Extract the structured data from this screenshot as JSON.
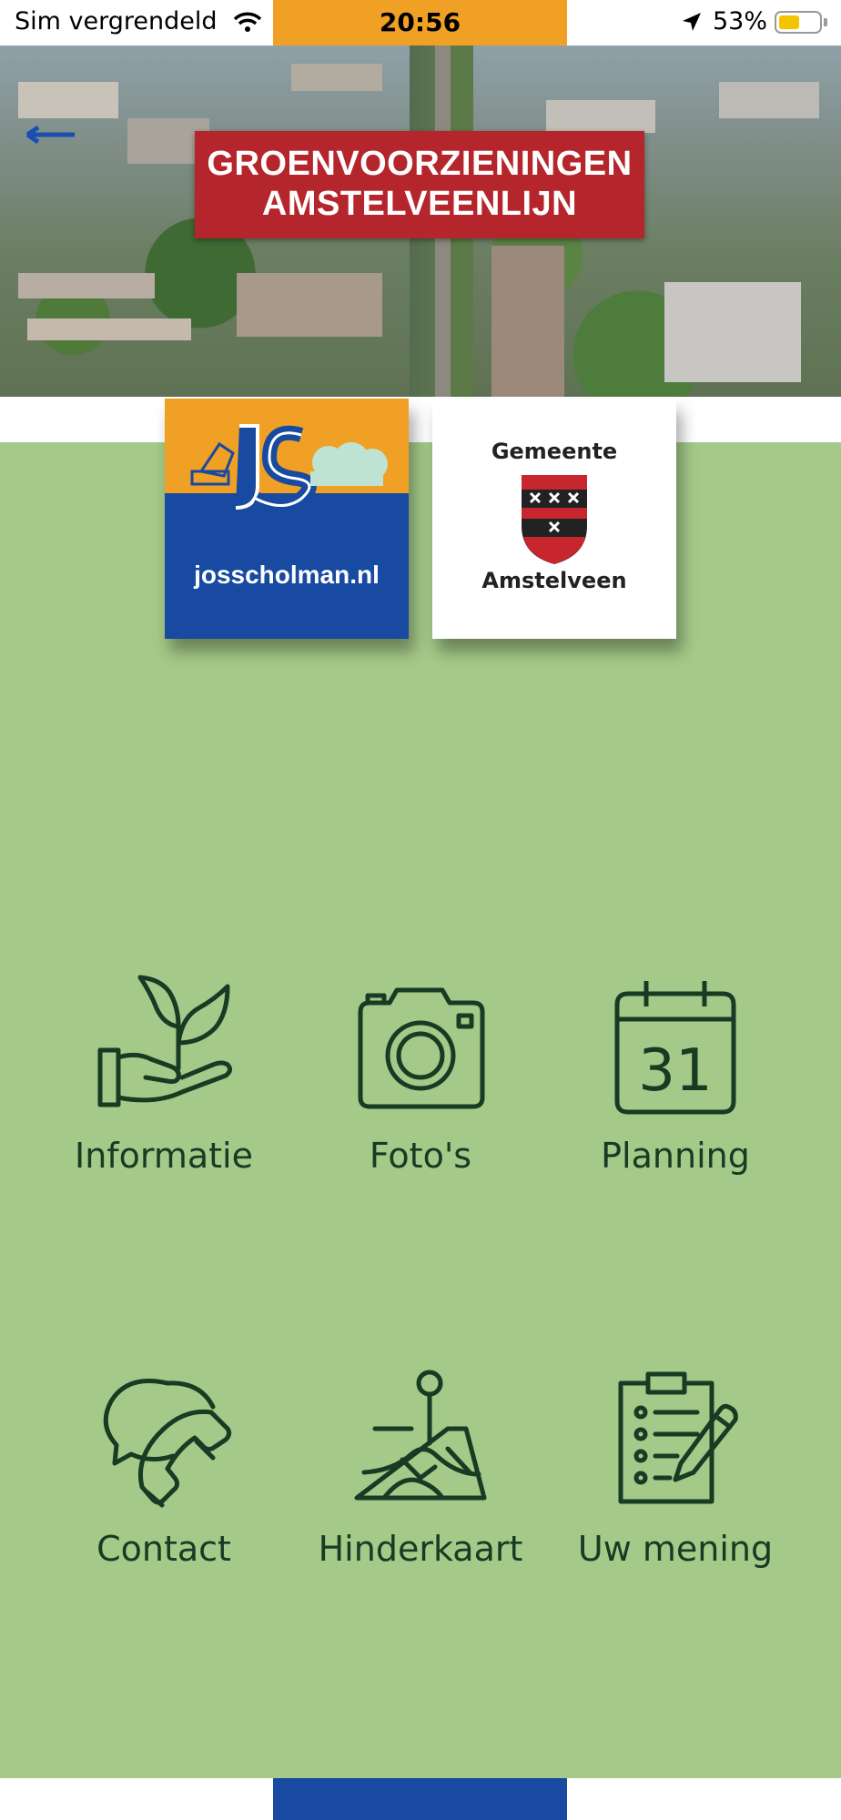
{
  "status_bar": {
    "carrier": "Sim vergrendeld",
    "time": "20:56",
    "battery": "53%",
    "battery_level": 0.53
  },
  "header": {
    "title_line1": "GROENVOORZIENINGEN",
    "title_line2": "AMSTELVEENLIJN"
  },
  "logos": {
    "contractor": "josscholman.nl",
    "municipality_top": "Gemeente",
    "municipality_bottom": "Amstelveen"
  },
  "menu": [
    {
      "label": "Informatie",
      "icon": "plant-hand-icon"
    },
    {
      "label": "Foto's",
      "icon": "camera-icon"
    },
    {
      "label": "Planning",
      "icon": "calendar-icon",
      "icon_text": "31"
    },
    {
      "label": "Contact",
      "icon": "chat-phone-icon"
    },
    {
      "label": "Hinderkaart",
      "icon": "map-pin-icon"
    },
    {
      "label": "Uw mening",
      "icon": "clipboard-pen-icon"
    }
  ],
  "colors": {
    "green_bg": "#a4c988",
    "orange": "#f0a024",
    "blue": "#174aa0",
    "banner_red": "#b5262c",
    "icon_dark": "#173b23"
  }
}
